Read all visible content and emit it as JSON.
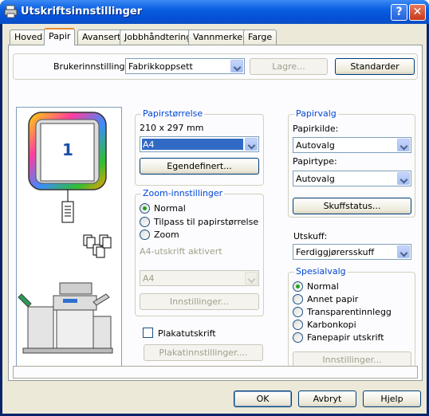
{
  "window": {
    "title": "Utskriftsinnstillinger",
    "help_label": "?",
    "close_label": "✕"
  },
  "tabs": [
    {
      "label": "Hoved",
      "active": false
    },
    {
      "label": "Papir",
      "active": true
    },
    {
      "label": "Avansert",
      "active": false
    },
    {
      "label": "Jobbhåndtering",
      "active": false
    },
    {
      "label": "Vannmerker",
      "active": false
    },
    {
      "label": "Farge",
      "active": false
    }
  ],
  "user_settings": {
    "label": "Brukerinnstillinger:",
    "value": "Fabrikkoppsett",
    "save_label": "Lagre...",
    "defaults_label": "Standarder"
  },
  "preview": {
    "page_number": "1"
  },
  "paper_size": {
    "group_label": "Papirstørrelse",
    "dimensions": "210 x 297 mm",
    "value": "A4",
    "custom_label": "Egendefinert..."
  },
  "zoom": {
    "group_label": "Zoom-innstillinger",
    "options": [
      "Normal",
      "Tilpass til papirstørrelse",
      "Zoom"
    ],
    "selected": 0,
    "active_text": "A4-utskrift aktivert",
    "size_value": "A4",
    "settings_label": "Innstillinger..."
  },
  "poster": {
    "checkbox_label": "Plakatutskrift",
    "checked": false,
    "settings_label": "Plakatinnstillinger...."
  },
  "paper_select": {
    "group_label": "Papirvalg",
    "source_label": "Papirkilde:",
    "source_value": "Autovalg",
    "type_label": "Papirtype:",
    "type_value": "Autovalg",
    "tray_status_label": "Skuffstatus..."
  },
  "output": {
    "label": "Utskuff:",
    "value": "Ferdiggjørersskuff"
  },
  "special": {
    "group_label": "Spesialvalg",
    "options": [
      "Normal",
      "Annet papir",
      "Transparentinnlegg",
      "Karbonkopi",
      "Fanepapir utskrift"
    ],
    "selected": 0,
    "settings_label": "Innstillinger..."
  },
  "footer": {
    "ok_label": "OK",
    "cancel_label": "Avbryt",
    "help_label": "Hjelp"
  },
  "colors": {
    "title_blue": "#0552d8",
    "group_label": "#0046d5",
    "tab_accent": "#e68b2c",
    "selection": "#316ac5"
  }
}
